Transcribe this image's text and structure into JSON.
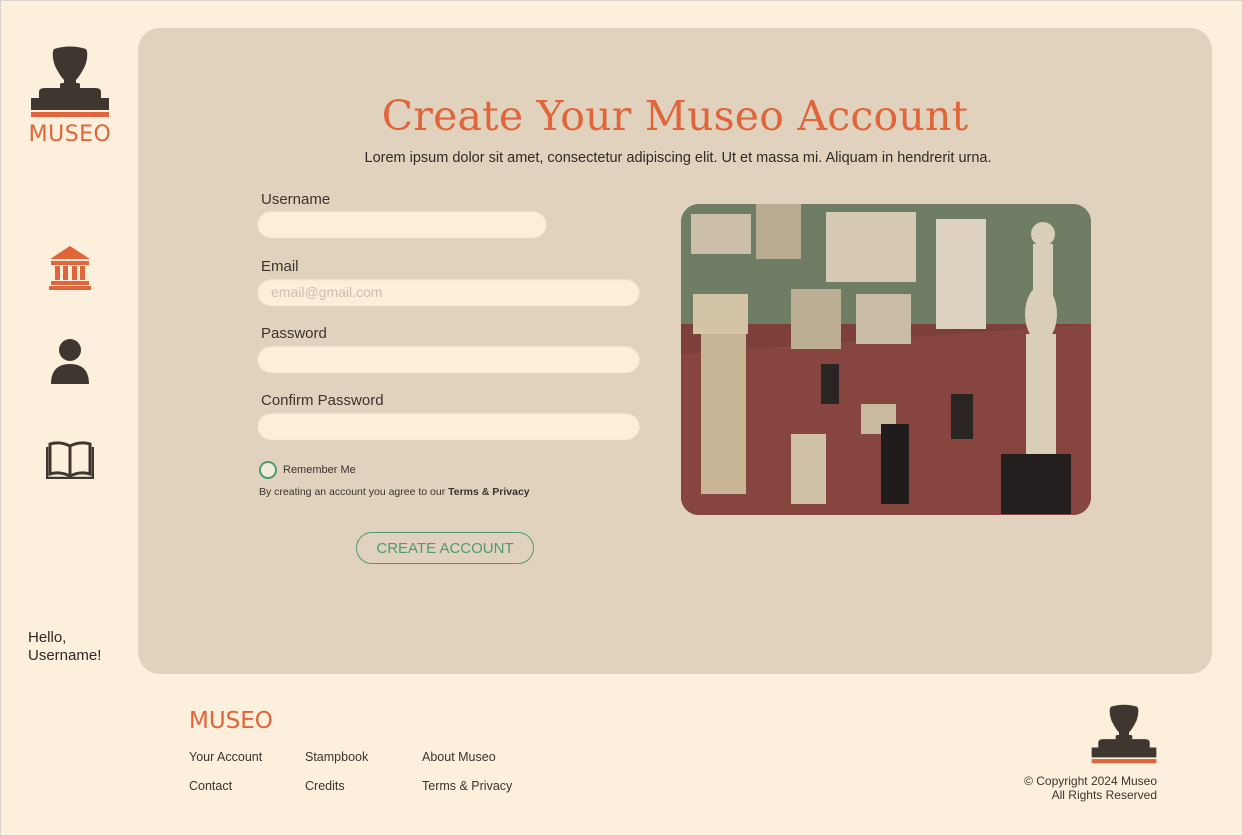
{
  "brand": {
    "name": "MUSEO"
  },
  "sidebar": {
    "nav": [
      {
        "icon": "museum-icon"
      },
      {
        "icon": "user-icon"
      },
      {
        "icon": "book-icon"
      }
    ],
    "greeting_line1": "Hello,",
    "greeting_line2": "Username!"
  },
  "form": {
    "title": "Create Your Museo Account",
    "subtitle": "Lorem ipsum dolor sit amet, consectetur adipiscing elit. Ut et massa mi. Aliquam in hendrerit urna.",
    "username_label": "Username",
    "username_value": "",
    "email_label": "Email",
    "email_placeholder": "email@gmail.com",
    "password_label": "Password",
    "confirm_label": "Confirm Password",
    "remember_label": "Remember Me",
    "terms_prefix": "By creating an account you agree to our ",
    "terms_link": "Terms & Privacy",
    "submit_label": "CREATE ACCOUNT"
  },
  "footer": {
    "logo": "MUSEO",
    "links": [
      "Your Account",
      "Stampbook",
      "About Museo",
      "Contact",
      "Credits",
      "Terms & Privacy"
    ],
    "copyright_line1": "© Copyright 2024 Museo",
    "copyright_line2": "All Rights Reserved"
  },
  "colors": {
    "background": "#fcf0dc",
    "card": "#e1d2bd",
    "accent": "#e0653a",
    "green": "#4e9a71",
    "dark": "#3f3630"
  }
}
